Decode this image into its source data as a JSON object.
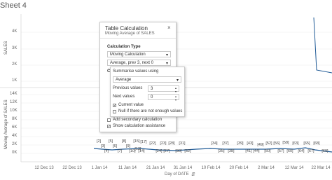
{
  "sheet_title": "Sheet 4",
  "top_chart": {
    "y_axis_title": "SALES",
    "y_ticks": [
      "4K",
      "3K",
      "2K",
      "1K"
    ]
  },
  "bottom_chart": {
    "y_axis_title": "Moving Average of SALES",
    "y_ticks": [
      "14K",
      "12K",
      "10K",
      "8K",
      "6K",
      "4K",
      "2K",
      "0K"
    ],
    "x_axis_title": "Day of DATE",
    "x_ticks": [
      "12 Dec 13",
      "22 Dec 13",
      "1 Jan 14",
      "11 Jan 14",
      "21 Jan 14",
      "31 Jan 14",
      "10 Feb 14",
      "20 Feb 14",
      "2 Mar 14",
      "12 Mar 14",
      "22 Mar 14"
    ],
    "point_labels": [
      "[2]",
      "[3]",
      "[4]",
      "[5]",
      "[6]",
      "[7]",
      "[8]",
      "[9]",
      "[10]",
      "[15]",
      "[12]",
      "[17]",
      "[14]",
      "[22]",
      "[24]",
      "[23]",
      "[27]",
      "[28]",
      "[30]",
      "[31]",
      "[32]",
      "[34]",
      "[35]",
      "[37]",
      "[38]",
      "[39]",
      "[41]",
      "[43]",
      "[44]",
      "[49]",
      "[50]",
      "[52]",
      "[56]",
      "[57]",
      "[58]",
      "[60]",
      "[63]",
      "[64]",
      "[65]",
      "[67]",
      "[68]",
      "[69]"
    ]
  },
  "table_calc_dialog": {
    "title": "Table Calculation",
    "subtitle": "Moving Average of SALES",
    "close_glyph": "×",
    "calc_type_label": "Calculation Type",
    "calc_type_value": "Moving Calculation",
    "calc_range_value": "Average, prev 3, next 0",
    "dropdown_caret": "▾",
    "compute_partial": "C",
    "add_secondary_label": "Add secondary calculation",
    "show_assistance_label": "Show calculation assistance",
    "show_assistance_checked": "✓"
  },
  "summarise_popup": {
    "title": "Summarise values using",
    "aggregation_value": "Average",
    "previous_values_label": "Previous values",
    "previous_values": "3",
    "next_values_label": "Next values",
    "next_values": "0",
    "current_value_label": "Current value",
    "current_value_checked": "✓",
    "null_label": "Null if there are not enough values"
  },
  "colors": {
    "line": "#1f5a96",
    "grid": "#ececec",
    "accent": "#1f5a96"
  }
}
